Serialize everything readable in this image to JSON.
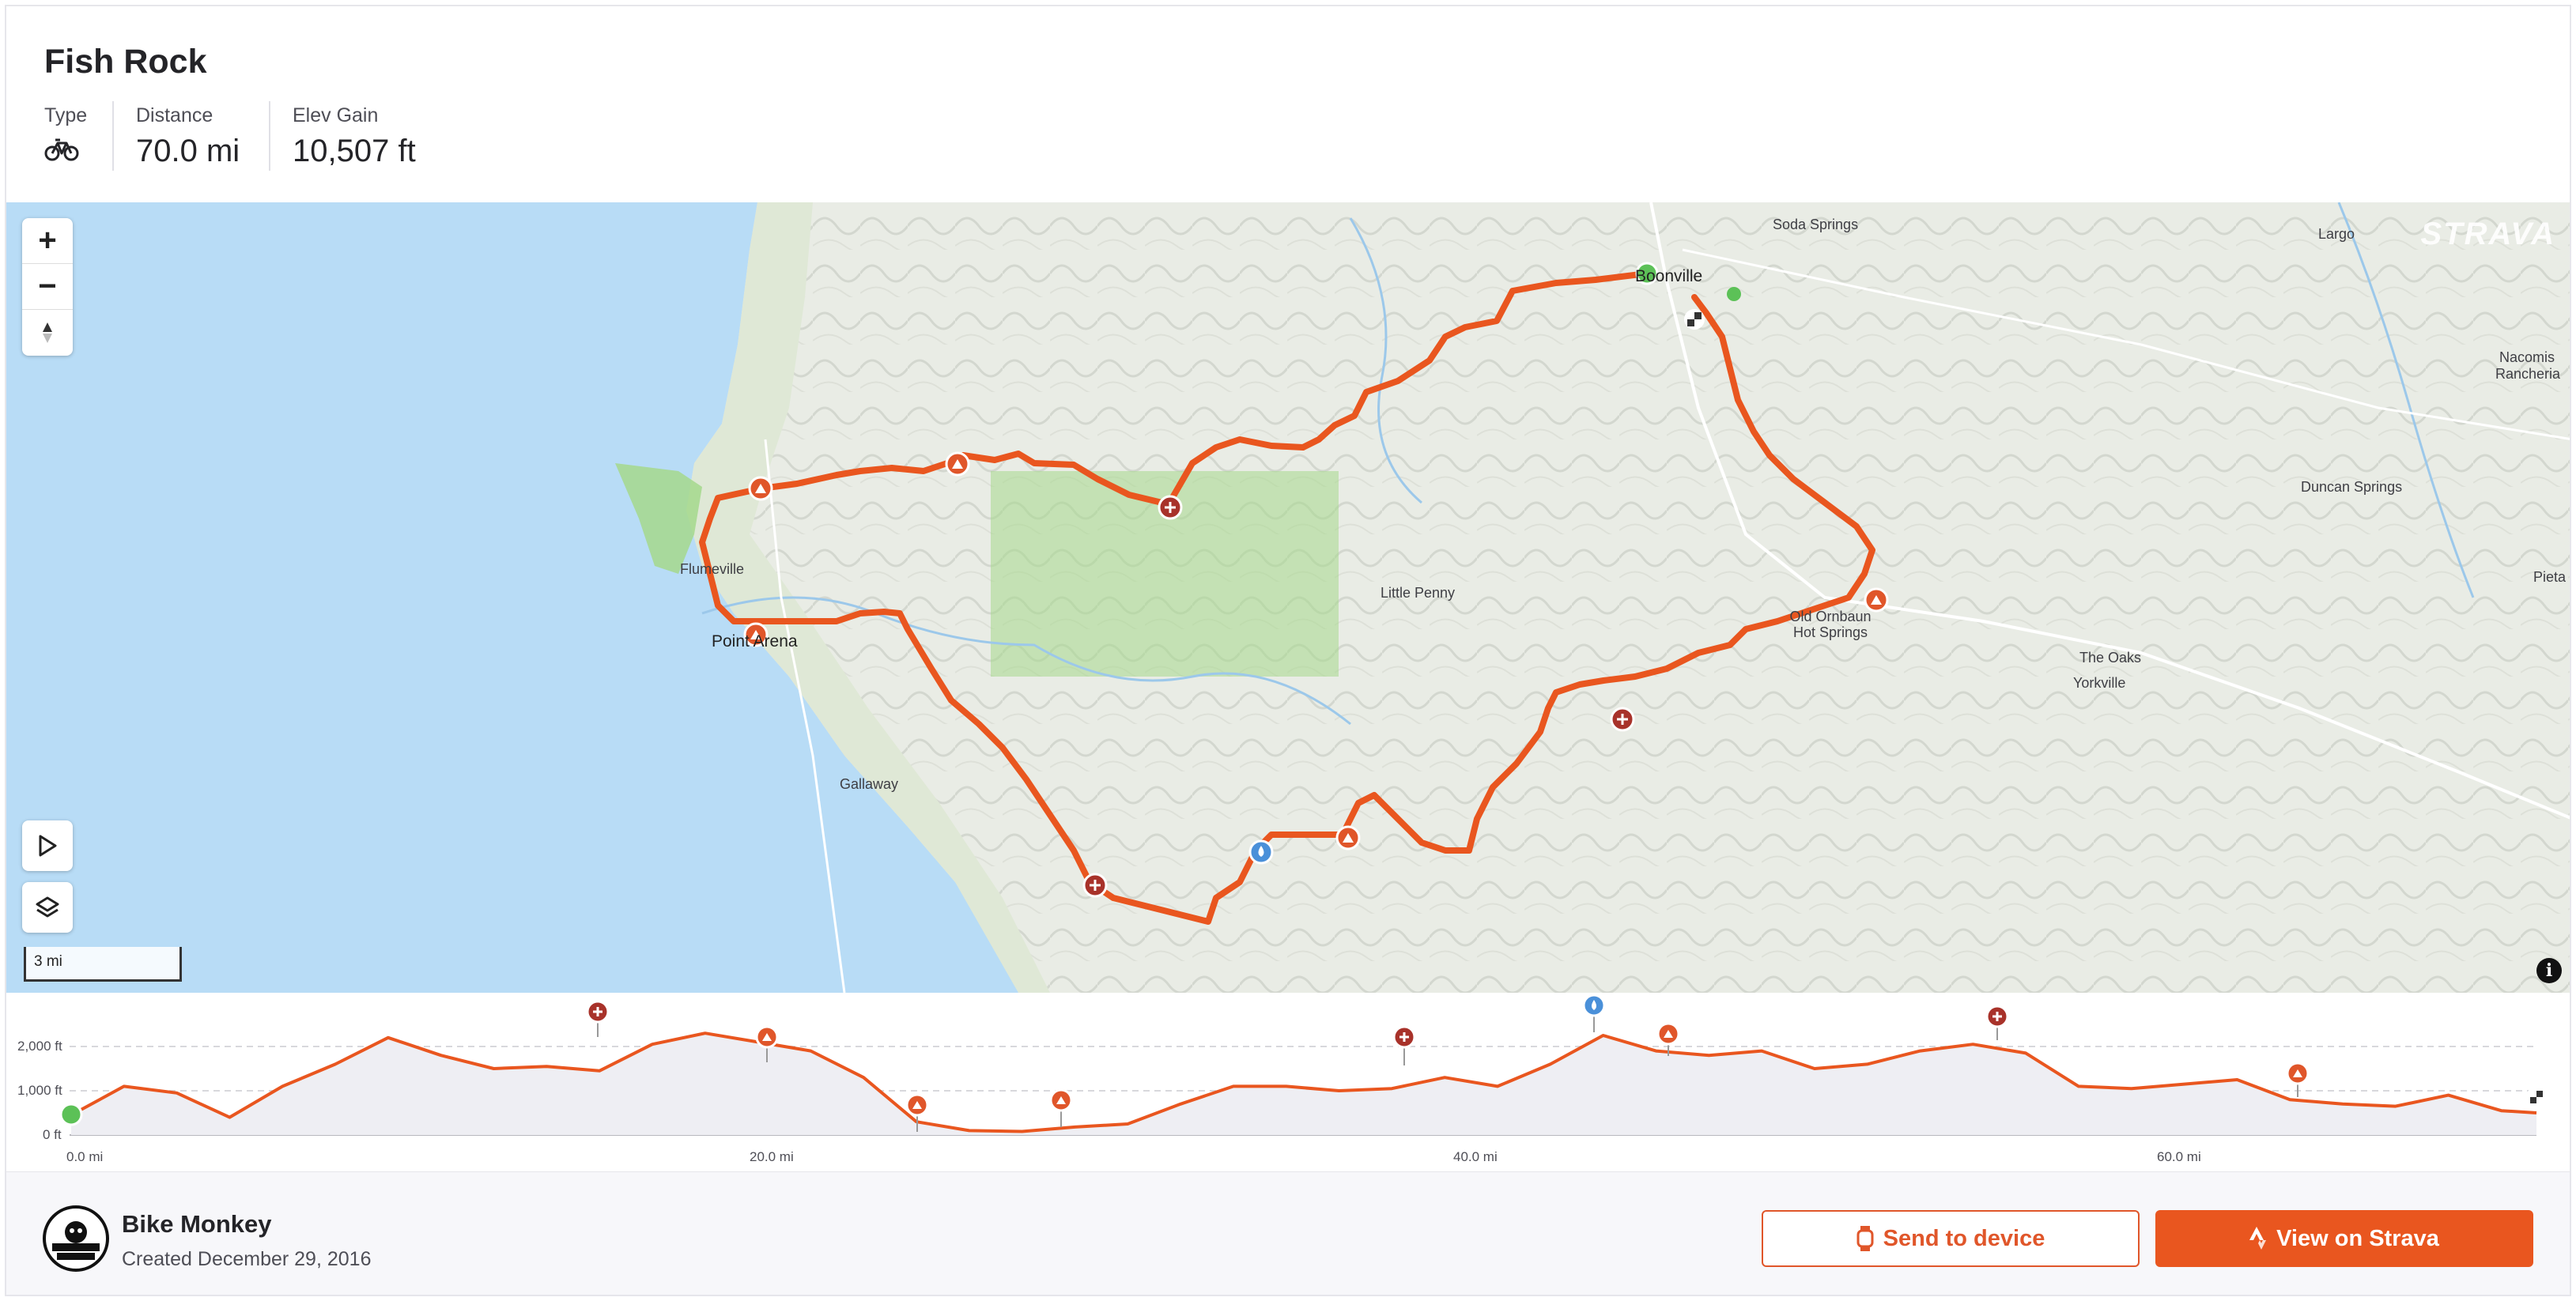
{
  "route": {
    "title": "Fish Rock"
  },
  "stats": {
    "type_label": "Type",
    "type_icon": "bicycle-icon",
    "distance_label": "Distance",
    "distance_value": "70.0 mi",
    "elev_gain_label": "Elev Gain",
    "elev_gain_value": "10,507 ft"
  },
  "map": {
    "brand": "STRAVA",
    "zoom_in": "+",
    "zoom_out": "−",
    "scale": "3 mi",
    "info": "i",
    "route_color": "#e9561f",
    "water_color": "#b8dcf6",
    "park_color": "#a5d88c",
    "labels": {
      "boonville": "Boonville",
      "soda_springs": "Soda Springs",
      "largo": "Largo",
      "nacomis": "Nacomis Rancheria",
      "duncan_springs": "Duncan Springs",
      "pieta": "Pieta",
      "little_penny": "Little Penny",
      "old_orr": "Old Ornbaun Hot Springs",
      "the_oaks": "The Oaks",
      "yorkville": "Yorkville",
      "flumeville": "Flumeville",
      "point_arena": "Point Arena",
      "gallaway": "Gallaway"
    },
    "icons": [
      "zoom-in-icon",
      "zoom-out-icon",
      "compass-icon",
      "play-icon",
      "layers-icon",
      "info-icon",
      "start-marker-icon",
      "finish-flag-icon",
      "climb-icon",
      "first-aid-icon",
      "water-icon"
    ]
  },
  "elevation": {
    "y_ticks": [
      "2,000 ft",
      "1,000 ft",
      "0 ft"
    ],
    "x_ticks": [
      "0.0 mi",
      "20.0 mi",
      "40.0 mi",
      "60.0 mi"
    ],
    "profile_mi": [
      0,
      1.5,
      3,
      4.5,
      6,
      7.5,
      9,
      10.5,
      12,
      13.5,
      15,
      16.5,
      18,
      19.5,
      21,
      22.5,
      24,
      25.5,
      27,
      28.5,
      30,
      31.5,
      33,
      34.5,
      36,
      37.5,
      39,
      40.5,
      42,
      43.5,
      45,
      46.5,
      48,
      49.5,
      51,
      52.5,
      54,
      55.5,
      57,
      58.5,
      60,
      61.5,
      63,
      64.5,
      66,
      67.5,
      69,
      70
    ],
    "profile_ft": [
      450,
      1100,
      950,
      400,
      1100,
      1600,
      2200,
      1800,
      1500,
      1550,
      1450,
      2050,
      2300,
      2100,
      1900,
      1300,
      300,
      100,
      80,
      180,
      250,
      700,
      1100,
      1100,
      1000,
      1050,
      1300,
      1100,
      1600,
      2250,
      1900,
      1800,
      1900,
      1500,
      1600,
      1900,
      2050,
      1850,
      1100,
      1050,
      1150,
      1250,
      800,
      700,
      650,
      900,
      550,
      500
    ]
  },
  "author": {
    "name": "Bike Monkey",
    "created": "Created December 29, 2016",
    "avatar_icon": "bike-monkey-logo"
  },
  "actions": {
    "send_label": "Send to device",
    "strava_label": "View on Strava"
  }
}
